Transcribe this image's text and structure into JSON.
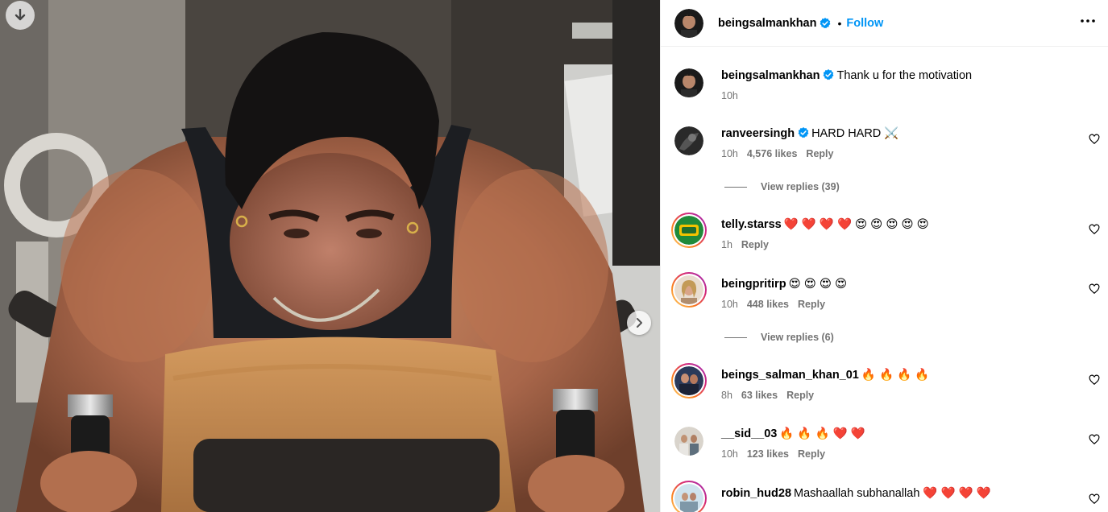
{
  "post": {
    "username": "beingsalmankhan",
    "separator": "•",
    "follow_label": "Follow"
  },
  "caption": {
    "username": "beingsalmankhan",
    "text": "Thank u for the motivation",
    "time": "10h"
  },
  "comments": [
    {
      "username": "ranveersingh",
      "verified": true,
      "text": "HARD HARD ⚔️",
      "time": "10h",
      "likes": "4,576 likes",
      "reply": "Reply",
      "view_replies": "View replies (39)"
    },
    {
      "username": "telly.starss",
      "text": "❤️ ❤️ ❤️ ❤️ 😍 😍 😍 😍 😍",
      "time": "1h",
      "reply": "Reply"
    },
    {
      "username": "beingpritirp",
      "text": "😍 😍 😍 😍",
      "time": "10h",
      "likes": "448 likes",
      "reply": "Reply",
      "view_replies": "View replies (6)"
    },
    {
      "username": "beings_salman_khan_01",
      "text": "🔥 🔥 🔥 🔥",
      "time": "8h",
      "likes": "63 likes",
      "reply": "Reply"
    },
    {
      "username": "__sid__03",
      "text": "🔥 🔥 🔥 ❤️ ❤️",
      "time": "10h",
      "likes": "123 likes",
      "reply": "Reply"
    },
    {
      "username": "robin_hud28",
      "text": "Mashaallah subhanallah ❤️ ❤️ ❤️ ❤️"
    }
  ],
  "colors": {
    "accent": "#0095f6",
    "verified": "#0095f6",
    "secondary_text": "#737373"
  },
  "icons": {
    "download": "download-icon",
    "next": "chevron-right-icon",
    "more": "more-options-icon",
    "like": "heart-icon",
    "verified": "verified-badge-icon"
  }
}
